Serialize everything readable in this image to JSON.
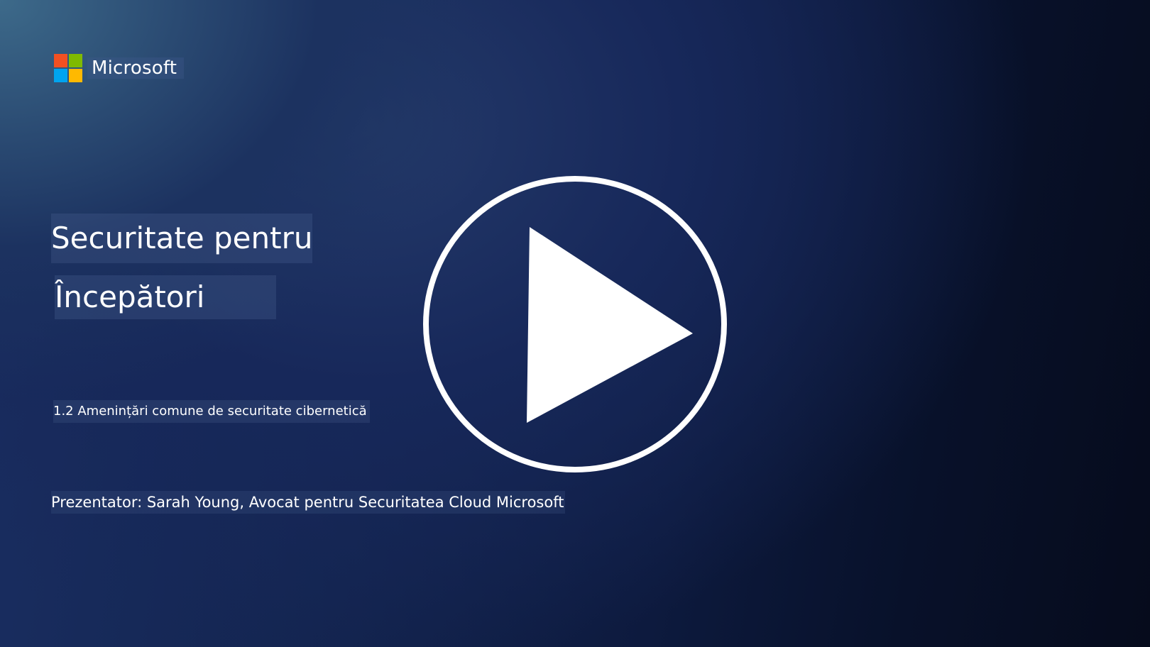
{
  "brand": {
    "name": "Microsoft",
    "logo_colors": [
      "#f25022",
      "#7fba00",
      "#00a4ef",
      "#ffb900"
    ]
  },
  "title": {
    "line1": "Securitate pentru",
    "line2": "Începători"
  },
  "subtitle": "1.2 Amenințări comune de securitate cibernetică",
  "presenter": "Prezentator: Sarah Young, Avocat pentru Securitatea Cloud Microsoft",
  "video": {
    "play_icon": "play-icon",
    "accent_color": "#ffffff"
  }
}
